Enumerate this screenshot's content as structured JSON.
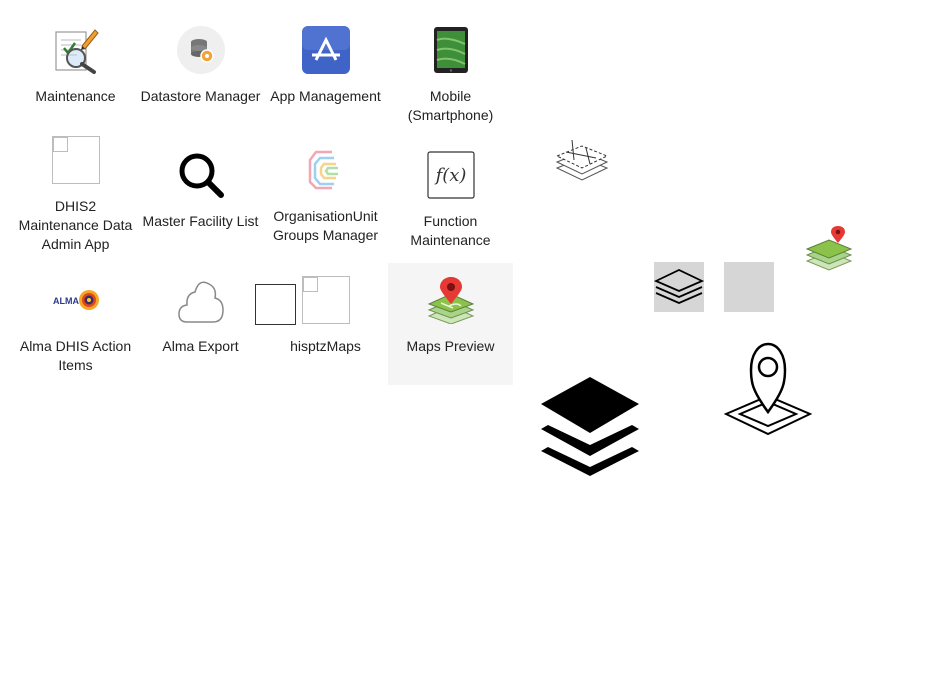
{
  "apps": [
    {
      "id": "maintenance",
      "label": "Maintenance",
      "icon": "maintenance-pencil-icon"
    },
    {
      "id": "datastore",
      "label": "Datastore Manager",
      "icon": "datastore-gear-icon"
    },
    {
      "id": "app-management",
      "label": "App Management",
      "icon": "app-store-icon"
    },
    {
      "id": "mobile",
      "label": "Mobile (Smartphone)",
      "icon": "tablet-icon"
    },
    {
      "id": "dhis2-maintenance",
      "label": "DHIS2 Maintenance Data Admin App",
      "icon": "broken-image-icon"
    },
    {
      "id": "master-facility",
      "label": "Master Facility List",
      "icon": "magnifier-icon"
    },
    {
      "id": "orgunit-groups",
      "label": "OrganisationUnit Groups Manager",
      "icon": "orgunit-groups-icon"
    },
    {
      "id": "function-maintenance",
      "label": "Function Maintenance",
      "icon": "function-fx-icon"
    },
    {
      "id": "alma-actions",
      "label": "Alma DHIS Action Items",
      "icon": "alma-logo-icon"
    },
    {
      "id": "alma-export",
      "label": "Alma Export",
      "icon": "cloud-icon"
    },
    {
      "id": "hisptz-maps",
      "label": "hisptzMaps",
      "icon": "broken-image-icon"
    },
    {
      "id": "maps-preview",
      "label": "Maps Preview",
      "icon": "map-layers-pin-icon"
    }
  ],
  "alma_logo_text": "ALMA",
  "colors": {
    "hover_bg": "#f5f5f5",
    "gray_tile": "#d6d6d6",
    "pin_red": "#e53935",
    "map_green": "#8bc34a",
    "app_store_blue": "#3f63c6"
  }
}
